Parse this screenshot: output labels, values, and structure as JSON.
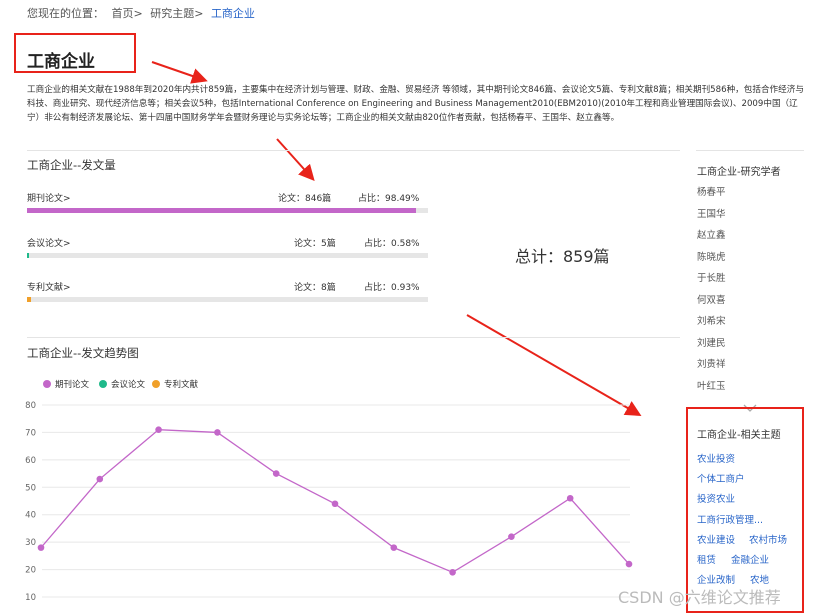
{
  "breadcrumb": {
    "prefix": "您现在的位置：",
    "home": "首页>",
    "topic": "研究主题>",
    "current": "工商企业"
  },
  "page_title": "工商企业",
  "description": "工商企业的相关文献在1988年到2020年内共计859篇，主要集中在经济计划与管理、财政、金融、贸易经济 等领域，其中期刊论文846篇、会议论文5篇、专利文献8篇；相关期刊586种，包括合作经济与科技、商业研究、现代经济信息等；相关会议5种，包括International Conference on Engineering and Business Management2010(EBM2010)(2010年工程和商业管理国际会议)、2009中国（辽宁）非公有制经济发展论坛、第十四届中国财务学年会暨财务理论与实务论坛等；工商企业的相关文献由820位作者贡献，包括杨春平、王国华、赵立鑫等。",
  "volume": {
    "heading": "工商企业--发文量",
    "rows": [
      {
        "label": "期刊论文>",
        "count": "论文：846篇",
        "ratio": "占比：98.49%",
        "pct": 98.49,
        "color": "#c367c9"
      },
      {
        "label": "会议论文>",
        "count": "论文：5篇",
        "ratio": "占比：0.58%",
        "pct": 0.58,
        "color": "#1fb98a"
      },
      {
        "label": "专利文献>",
        "count": "论文：8篇",
        "ratio": "占比：0.93%",
        "pct": 0.93,
        "color": "#f0a02a"
      }
    ],
    "total": "总计：859篇"
  },
  "trend": {
    "heading": "工商企业--发文趋势图"
  },
  "chart_data": {
    "type": "line",
    "legend": [
      "期刊论文",
      "会议论文",
      "专利文献"
    ],
    "legend_colors": [
      "#c367c9",
      "#1fb98a",
      "#f0a02a"
    ],
    "yticks": [
      "80",
      "70",
      "60",
      "50",
      "40",
      "30",
      "20",
      "10"
    ],
    "ylim": [
      10,
      80
    ],
    "series": [
      {
        "name": "期刊论文",
        "values": [
          28,
          53,
          71,
          70,
          55,
          44,
          28,
          19,
          32,
          46,
          22
        ],
        "color": "#c367c9"
      }
    ],
    "grid": true
  },
  "sidebar": {
    "scholars_title": "工商企业-研究学者",
    "scholars": [
      "杨春平",
      "王国华",
      "赵立鑫",
      "陈晓虎",
      "于长胜",
      "何双喜",
      "刘希宋",
      "刘建民",
      "刘贵祥",
      "叶红玉"
    ],
    "more_icon": "chevron-down-icon",
    "topics_title": "工商企业-相关主题",
    "topic_rows": [
      [
        "农业投资"
      ],
      [
        "个体工商户"
      ],
      [
        "投资农业"
      ],
      [
        "工商行政管理..."
      ],
      [
        "农业建设",
        "农村市场"
      ],
      [
        "租赁",
        "金融企业"
      ],
      [
        "企业改制",
        "农地"
      ]
    ]
  },
  "watermark": "CSDN @六维论文推荐"
}
